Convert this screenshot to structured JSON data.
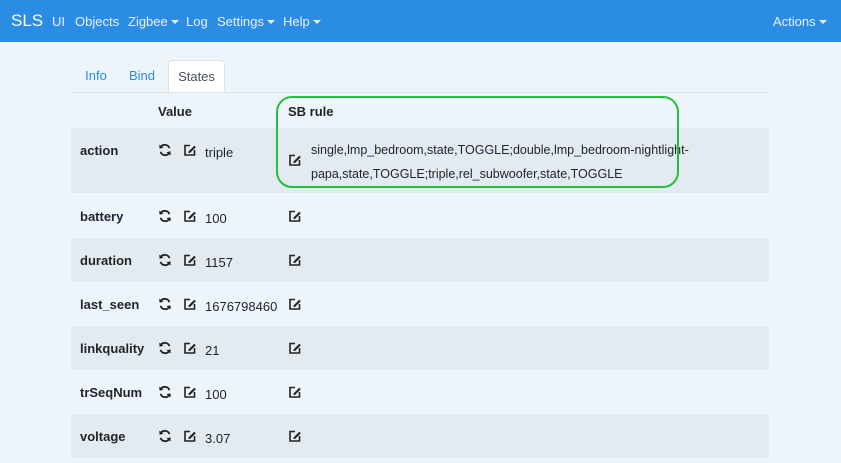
{
  "navbar": {
    "brand": "SLS",
    "items": [
      {
        "label": "UI",
        "dropdown": false
      },
      {
        "label": "Objects",
        "dropdown": false
      },
      {
        "label": "Zigbee",
        "dropdown": true
      },
      {
        "label": "Log",
        "dropdown": false
      },
      {
        "label": "Settings",
        "dropdown": true
      },
      {
        "label": "Help",
        "dropdown": true
      }
    ],
    "actions": "Actions"
  },
  "tabs": [
    {
      "label": "Info",
      "active": false
    },
    {
      "label": "Bind",
      "active": false
    },
    {
      "label": "States",
      "active": true
    }
  ],
  "table": {
    "headers": {
      "value": "Value",
      "rule": "SB rule"
    },
    "rows": [
      {
        "name": "action",
        "value": "triple",
        "rule": "single,lmp_bedroom,state,TOGGLE;double,lmp_bedroom-nightlight-papa,state,TOGGLE;triple,rel_subwoofer,state,TOGGLE"
      },
      {
        "name": "battery",
        "value": "100",
        "rule": ""
      },
      {
        "name": "duration",
        "value": "1157",
        "rule": ""
      },
      {
        "name": "last_seen",
        "value": "1676798460",
        "rule": ""
      },
      {
        "name": "linkquality",
        "value": "21",
        "rule": ""
      },
      {
        "name": "trSeqNum",
        "value": "100",
        "rule": ""
      },
      {
        "name": "voltage",
        "value": "3.07",
        "rule": ""
      }
    ]
  },
  "icons": {
    "refresh": "refresh-icon",
    "edit": "edit-icon"
  },
  "colors": {
    "navbar": "#2b8ce4",
    "highlight": "#22c040",
    "stripe": "#e4ebf0",
    "background": "#eef5fa"
  }
}
